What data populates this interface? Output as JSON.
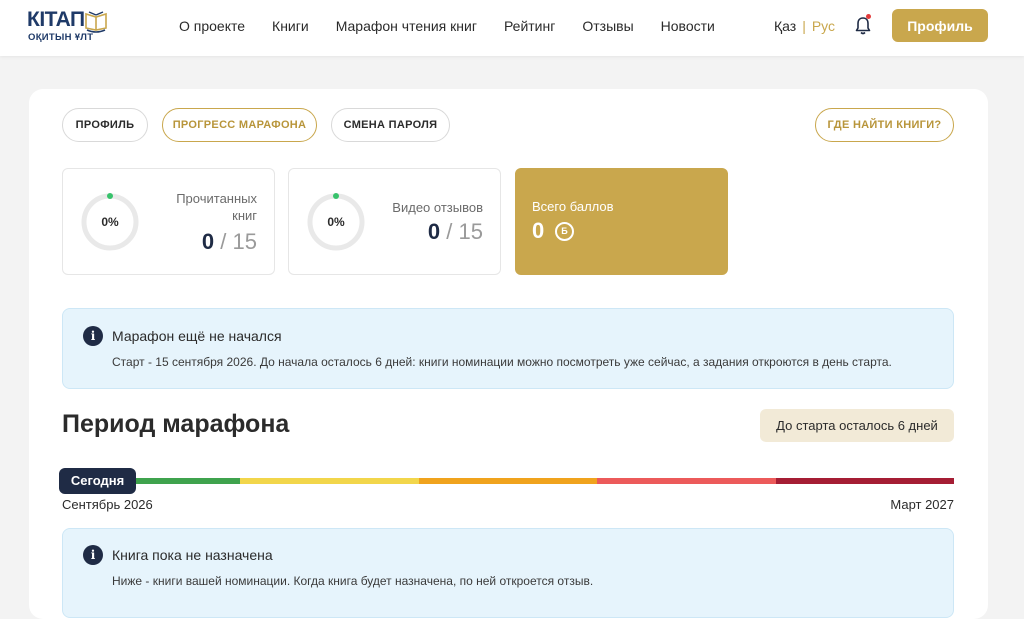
{
  "brand": {
    "name": "КІТАП",
    "subtitle": "ОҚИТЫН ҰЛТ"
  },
  "nav": {
    "items": [
      {
        "label": "О проекте"
      },
      {
        "label": "Книги"
      },
      {
        "label": "Марафон чтения книг"
      },
      {
        "label": "Рейтинг"
      },
      {
        "label": "Отзывы"
      },
      {
        "label": "Новости"
      }
    ]
  },
  "lang": {
    "kz": "Қаз",
    "separator": "|",
    "ru": "Рус",
    "active": "ru"
  },
  "header": {
    "profile_button": "Профиль",
    "notification_icon": "bell-icon"
  },
  "tabs": [
    {
      "label": "ПРОФИЛЬ",
      "active": false
    },
    {
      "label": "ПРОГРЕСС МАРАФОНА",
      "active": true
    },
    {
      "label": "СМЕНА ПАРОЛЯ",
      "active": false
    }
  ],
  "where_books": "ГДЕ НАЙТИ КНИГИ?",
  "stats": {
    "books": {
      "percent_label": "0%",
      "progress": 0,
      "title_line1": "Прочитанных",
      "title_line2": "книг",
      "current": "0",
      "slash": "/",
      "total": "15"
    },
    "videos": {
      "percent_label": "0%",
      "progress": 0,
      "title": "Видео отзывов",
      "current": "0",
      "slash": "/",
      "total": "15"
    },
    "points": {
      "title": "Всего баллов",
      "value": "0",
      "badge": "Б"
    }
  },
  "notice_start": {
    "title": "Марафон ещё не начался",
    "text": "Старт - 15 сентября 2026. До начала осталось 6 дней: книги номинации можно посмотреть уже сейчас, а задания откроются в день старта."
  },
  "period": {
    "title": "Период марафона",
    "countdown": "До старта осталось 6 дней",
    "today_label": "Сегодня",
    "start_label": "Сентябрь 2026",
    "end_label": "Март 2027",
    "segment_colors": [
      "#3fa34d",
      "#f2d64b",
      "#f0a31d",
      "#ec5a5a",
      "#a51d34"
    ]
  },
  "notice_book": {
    "title": "Книга пока не назначена",
    "text": "Ниже - книги вашей номинации. Когда книга будет назначена, по ней откроется отзыв."
  },
  "colors": {
    "accent": "#c9a74d",
    "navy": "#1f2b45",
    "info_bg": "#e6f4fc",
    "progress_green": "#37c26b"
  }
}
